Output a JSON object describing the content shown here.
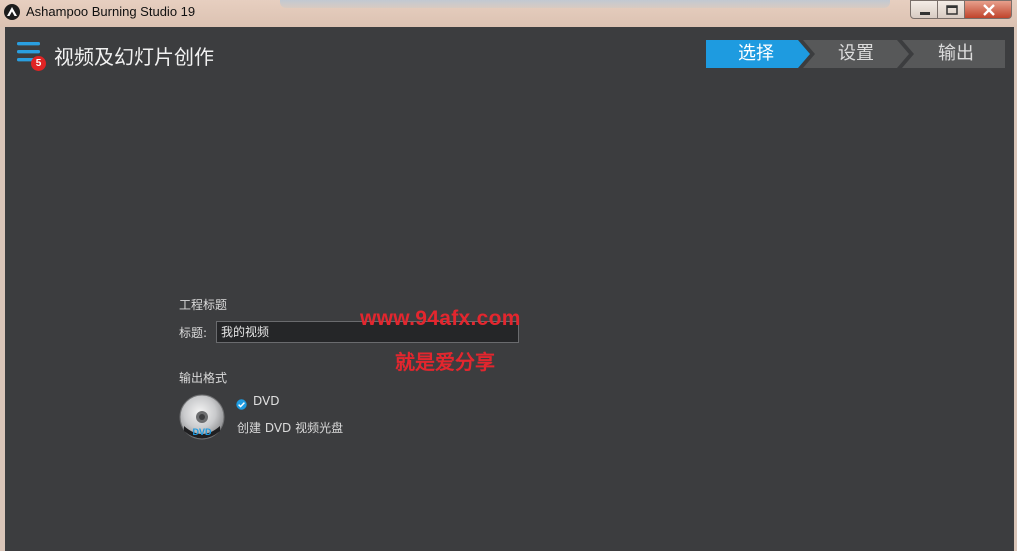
{
  "window": {
    "title": "Ashampoo Burning Studio 19",
    "controls": [
      "minimize",
      "maximize",
      "close"
    ]
  },
  "header": {
    "menu_badge": "5",
    "page_title": "视频及幻灯片创作"
  },
  "steps": [
    {
      "label": "选择",
      "active": true
    },
    {
      "label": "设置",
      "active": false
    },
    {
      "label": "输出",
      "active": false
    }
  ],
  "project": {
    "section_label": "工程标题",
    "field_label": "标题:",
    "title_value": "我的视频"
  },
  "output": {
    "section_label": "输出格式",
    "format_name": "DVD",
    "format_checked": true,
    "format_desc": "创建 DVD 视频光盘",
    "disc_label": "DVD"
  },
  "watermark": {
    "url": "www.94afx.com",
    "tagline": "就是爱分享"
  },
  "colors": {
    "accent": "#1e9be0",
    "background": "#3c3d3f",
    "step_inactive": "#575859",
    "watermark": "#e3262e"
  }
}
